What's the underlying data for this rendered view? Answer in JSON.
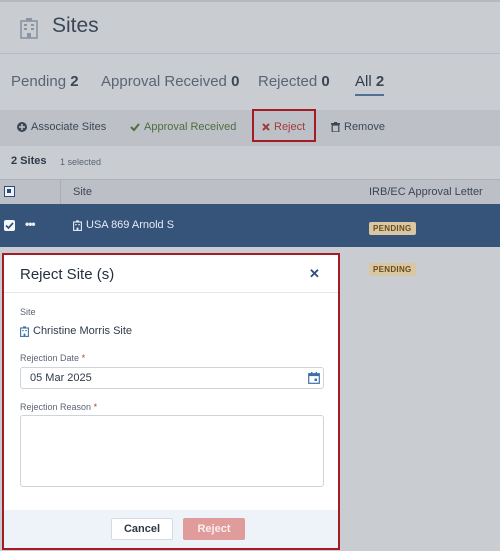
{
  "header": {
    "title": "Sites"
  },
  "tabs": [
    {
      "label": "Pending",
      "count": "2"
    },
    {
      "label": "Approval Received",
      "count": "0"
    },
    {
      "label": "Rejected",
      "count": "0"
    },
    {
      "label": "All",
      "count": "2"
    }
  ],
  "toolbar": {
    "associate": "Associate Sites",
    "approval": "Approval Received",
    "reject": "Reject",
    "remove": "Remove"
  },
  "list": {
    "count_label": "2 Sites",
    "selected_label": "1 selected",
    "columns": {
      "site": "Site",
      "irb": "IRB/EC Approval Letter"
    },
    "rows": [
      {
        "site": "USA 869 Arnold S",
        "status": "PENDING"
      },
      {
        "site": "",
        "status": "PENDING"
      }
    ]
  },
  "modal": {
    "title": "Reject Site (s)",
    "site_label": "Site",
    "site_value": "Christine Morris Site",
    "date_label": "Rejection Date",
    "date_value": "05 Mar 2025",
    "reason_label": "Rejection Reason",
    "required_mark": "*",
    "cancel": "Cancel",
    "reject": "Reject"
  },
  "colors": {
    "accent": "#36537a",
    "highlight_border": "#a31c23",
    "pending_badge": "#d9c6a3",
    "reject_button": "#e09b9b"
  }
}
